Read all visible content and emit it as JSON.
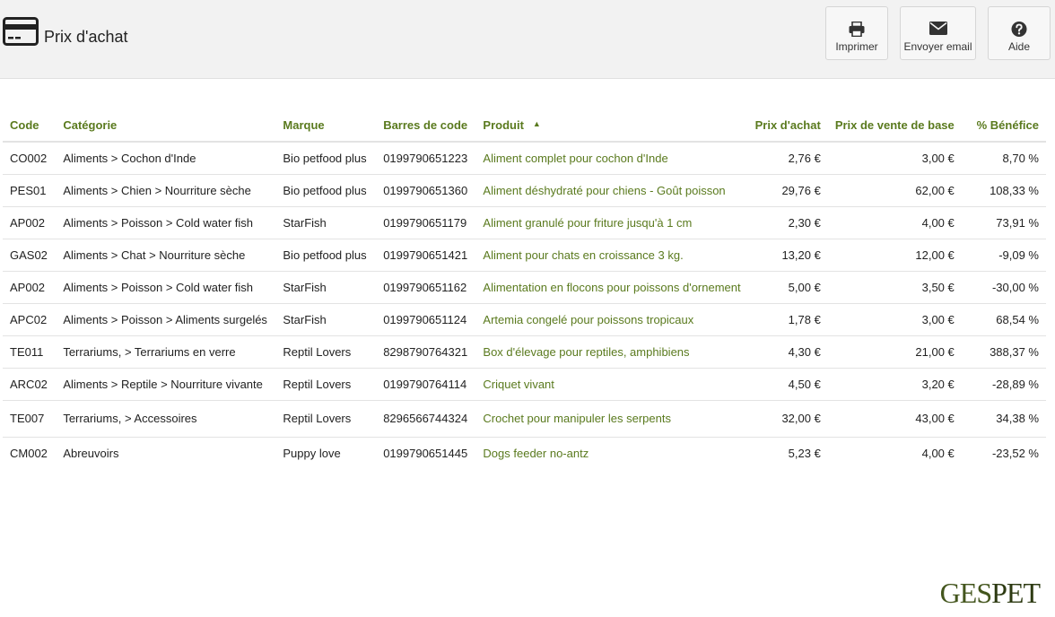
{
  "header": {
    "title": "Prix d'achat",
    "icon": "credit-card-icon",
    "buttons": {
      "print": {
        "label": "Imprimer",
        "icon": "printer-icon"
      },
      "email": {
        "label": "Envoyer email",
        "icon": "envelope-icon"
      },
      "help": {
        "label": "Aide",
        "icon": "help-icon"
      }
    }
  },
  "table": {
    "columns": {
      "code": "Code",
      "categorie": "Catégorie",
      "marque": "Marque",
      "barres": "Barres de code",
      "produit": "Produit",
      "prix_achat": "Prix d'achat",
      "prix_vente": "Prix de vente de base",
      "benefice": "% Bénéfice"
    },
    "sort": {
      "column": "produit",
      "direction": "ascending",
      "icon": "sort-up-icon"
    },
    "rows": [
      {
        "code": "CO002",
        "categorie": "Aliments > Cochon d'Inde",
        "marque": "Bio petfood plus",
        "barres": "0199790651223",
        "produit": "Aliment complet pour cochon d'Inde",
        "prix_achat": "2,76 €",
        "prix_vente": "3,00 €",
        "benefice": "8,70 %"
      },
      {
        "code": "PES01",
        "categorie": "Aliments > Chien > Nourriture sèche",
        "marque": "Bio petfood plus",
        "barres": "0199790651360",
        "produit": "Aliment déshydraté pour chiens - Goût poisson",
        "prix_achat": "29,76 €",
        "prix_vente": "62,00 €",
        "benefice": "108,33 %"
      },
      {
        "code": "AP002",
        "categorie": "Aliments > Poisson > Cold water fish",
        "marque": "StarFish",
        "barres": "0199790651179",
        "produit": "Aliment granulé pour friture jusqu'à 1 cm",
        "prix_achat": "2,30 €",
        "prix_vente": "4,00 €",
        "benefice": "73,91 %"
      },
      {
        "code": "GAS02",
        "categorie": "Aliments > Chat > Nourriture sèche",
        "marque": "Bio petfood plus",
        "barres": "0199790651421",
        "produit": "Aliment pour chats en croissance 3 kg.",
        "prix_achat": "13,20 €",
        "prix_vente": "12,00 €",
        "benefice": "-9,09 %"
      },
      {
        "code": "AP002",
        "categorie": "Aliments > Poisson > Cold water fish",
        "marque": "StarFish",
        "barres": "0199790651162",
        "produit": "Alimentation en flocons pour poissons d'ornement",
        "prix_achat": "5,00 €",
        "prix_vente": "3,50 €",
        "benefice": "-30,00 %"
      },
      {
        "code": "APC02",
        "categorie": "Aliments > Poisson > Aliments surgelés",
        "marque": "StarFish",
        "barres": "0199790651124",
        "produit": "Artemia congelé pour poissons tropicaux",
        "prix_achat": "1,78 €",
        "prix_vente": "3,00 €",
        "benefice": "68,54 %"
      },
      {
        "code": "TE011",
        "categorie": "Terrariums, > Terrariums en verre",
        "marque": "Reptil Lovers",
        "barres": "8298790764321",
        "produit": "Box d'élevage pour reptiles, amphibiens",
        "prix_achat": "4,30 €",
        "prix_vente": "21,00 €",
        "benefice": "388,37 %"
      },
      {
        "code": "ARC02",
        "categorie": "Aliments > Reptile > Nourriture vivante",
        "marque": "Reptil Lovers",
        "barres": "0199790764114",
        "produit": "Criquet vivant",
        "prix_achat": "4,50 €",
        "prix_vente": "3,20 €",
        "benefice": "-28,89 %"
      },
      {
        "code": "TE007",
        "categorie": "Terrariums, > Accessoires",
        "marque": "Reptil Lovers",
        "barres": "8296566744324",
        "produit": "Crochet pour manipuler les serpents",
        "prix_achat": "32,00 €",
        "prix_vente": "43,00 €",
        "benefice": "34,38 %"
      },
      {
        "code": "CM002",
        "categorie": "Abreuvoirs",
        "marque": "Puppy love",
        "barres": "0199790651445",
        "produit": "Dogs feeder no-antz",
        "prix_achat": "5,23 €",
        "prix_vente": "4,00 €",
        "benefice": "-23,52 %"
      }
    ]
  },
  "brand": {
    "part1": "GES",
    "part2": "PET"
  },
  "colors": {
    "accent": "#5a7a1e",
    "header_bg": "#f2f2f2"
  }
}
